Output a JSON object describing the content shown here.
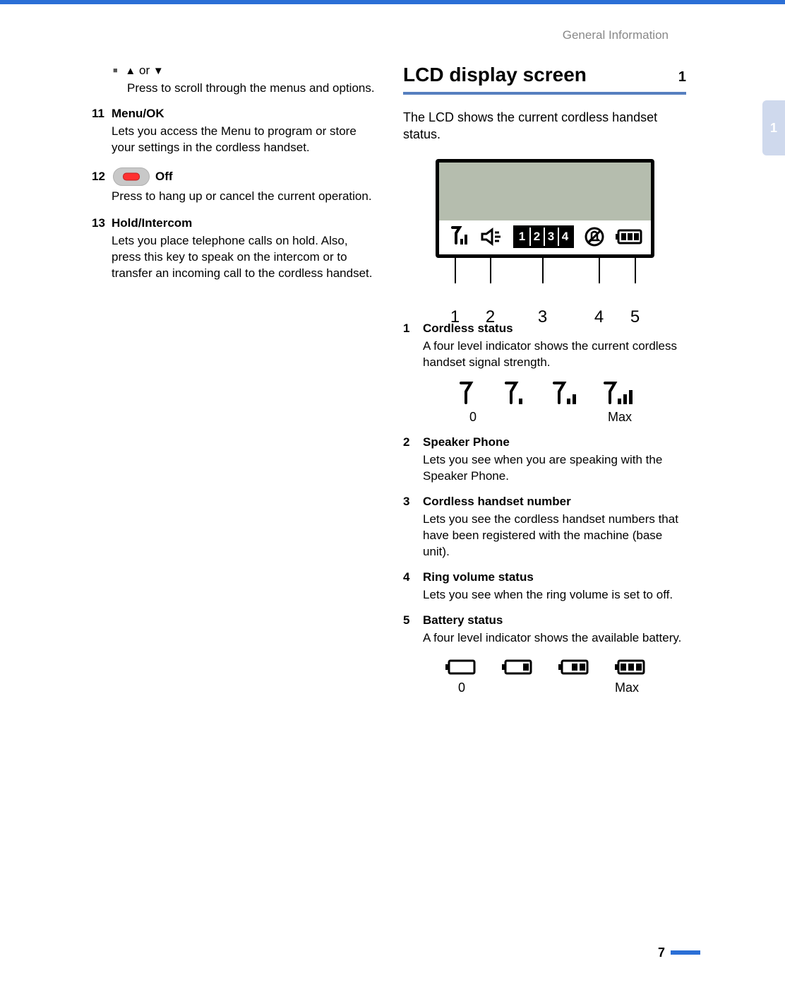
{
  "header": {
    "running_head": "General Information"
  },
  "side_tab": "1",
  "left_column": {
    "arrows": {
      "or_word": "or"
    },
    "arrows_desc": "Press to scroll through the menus and options.",
    "items": [
      {
        "num": "11",
        "title": "Menu/OK",
        "desc": "Lets you access the Menu to program or store your settings in the cordless handset."
      },
      {
        "num": "12",
        "title": "Off",
        "off_key": true,
        "desc": "Press to hang up or cancel the current operation."
      },
      {
        "num": "13",
        "title": "Hold/Intercom",
        "desc": "Lets you place telephone calls on hold. Also, press this key to speak on the intercom or to transfer an incoming call to the cordless handset."
      }
    ]
  },
  "right_column": {
    "heading": "LCD display screen",
    "tag": "1",
    "intro": "The LCD shows the current cordless handset status.",
    "lcd": {
      "handset_digits": [
        "1",
        "2",
        "3",
        "4"
      ],
      "callout_labels": [
        "1",
        "2",
        "3",
        "4",
        "5"
      ]
    },
    "legend": [
      {
        "num": "1",
        "title": "Cordless status",
        "desc": "A four level indicator shows the current cordless handset signal strength.",
        "levels_figure": "signal"
      },
      {
        "num": "2",
        "title": "Speaker Phone",
        "desc": "Lets you see when you are speaking with the Speaker Phone."
      },
      {
        "num": "3",
        "title": "Cordless handset number",
        "desc": "Lets you see the cordless handset numbers that have been registered with the machine (base unit)."
      },
      {
        "num": "4",
        "title": "Ring volume status",
        "desc": "Lets you see when the ring volume is set to off."
      },
      {
        "num": "5",
        "title": "Battery status",
        "desc": "A four level indicator shows the available battery.",
        "levels_figure": "battery"
      }
    ],
    "level_labels": {
      "min": "0",
      "max": "Max"
    }
  },
  "footer": {
    "page": "7"
  },
  "chart_data": [
    {
      "type": "bar",
      "title": "Signal strength indicator levels",
      "categories": [
        "0",
        "",
        "",
        "Max"
      ],
      "values": [
        0,
        1,
        2,
        3
      ],
      "ylim": [
        0,
        3
      ],
      "xlabel": "",
      "ylabel": ""
    },
    {
      "type": "bar",
      "title": "Battery indicator levels",
      "categories": [
        "0",
        "",
        "",
        "Max"
      ],
      "values": [
        0,
        1,
        2,
        3
      ],
      "ylim": [
        0,
        3
      ],
      "xlabel": "",
      "ylabel": ""
    }
  ]
}
